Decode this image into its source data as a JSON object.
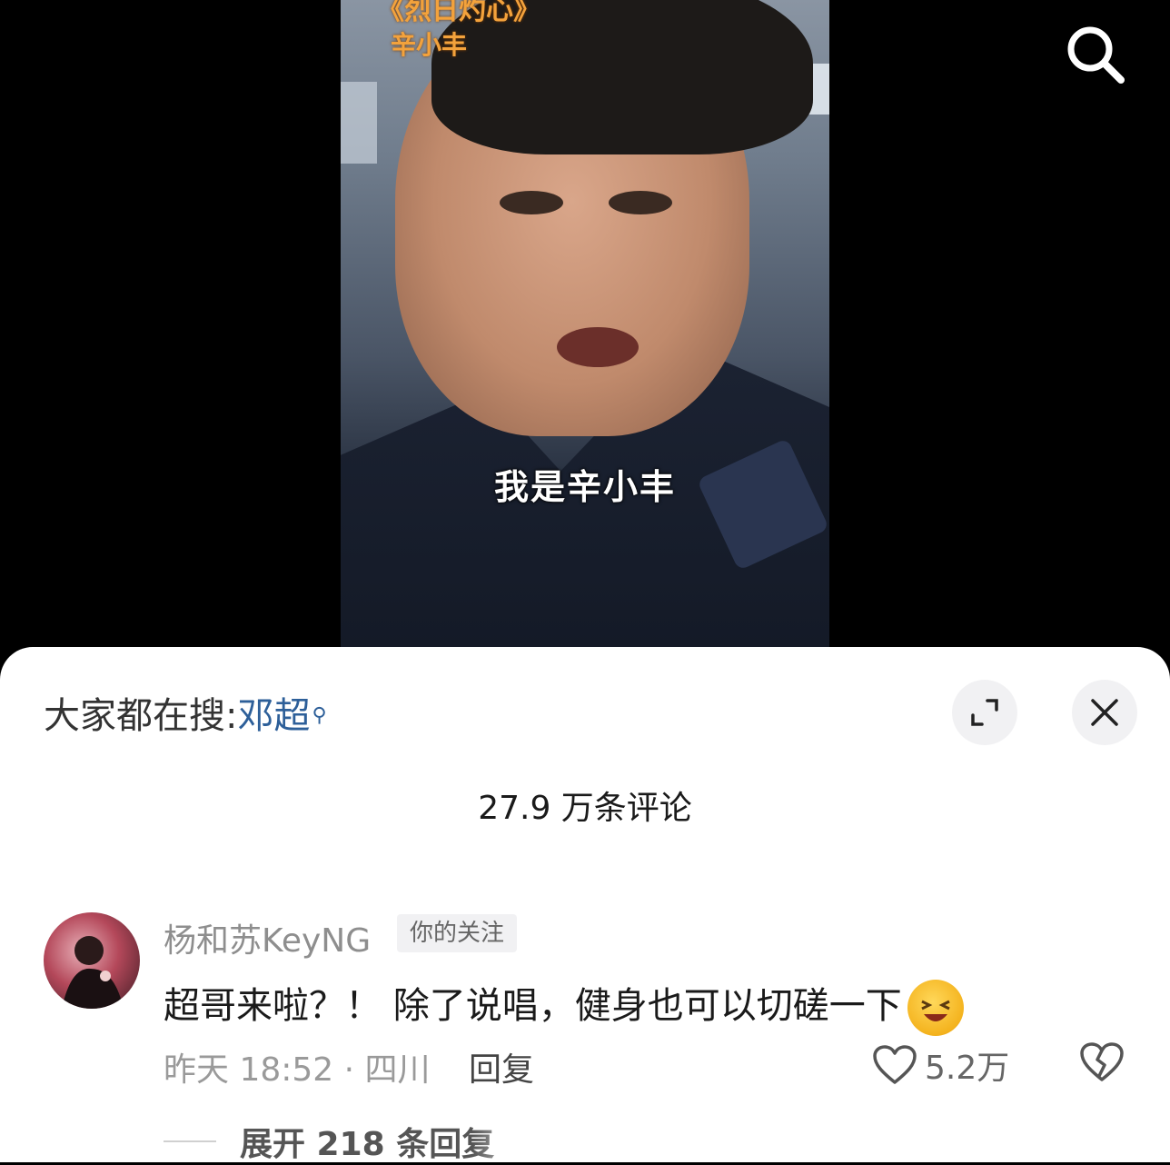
{
  "video": {
    "title": "《烈日灼心》",
    "subtitle": "辛小丰",
    "caption": "我是辛小丰"
  },
  "icons": {
    "search": "search-icon",
    "expand": "expand-icon",
    "close": "close-icon",
    "like": "heart-icon",
    "dislike": "broken-heart-icon",
    "emoji": "laughing-emoji"
  },
  "sheet": {
    "hot_search_prefix": "大家都在搜:",
    "hot_search_keyword": "邓超",
    "comment_count": "27.9 万条评论"
  },
  "comment": {
    "author": "杨和苏KeyNG",
    "tag": "你的关注",
    "text": "超哥来啦？！ 除了说唱，健身也可以切磋一下",
    "time_location": "昨天 18:52 · 四川",
    "reply_label": "回复",
    "like_count": "5.2万",
    "expand_replies": "展开 218 条回复"
  },
  "colors": {
    "keyword": "#2d5f99",
    "video_title": "#f3a23c"
  }
}
